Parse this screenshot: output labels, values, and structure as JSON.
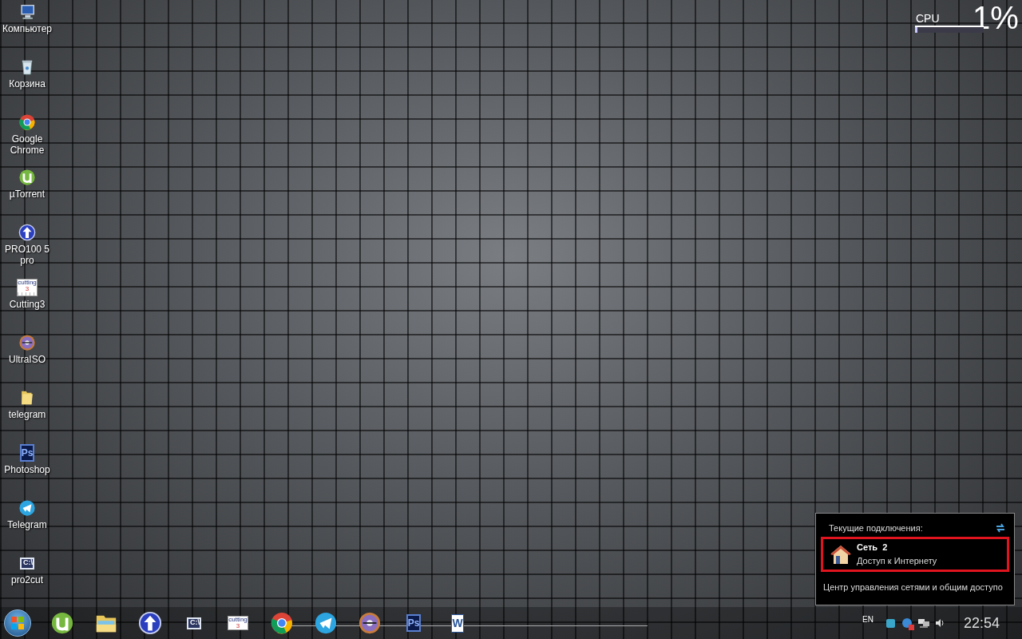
{
  "desktop_icons": [
    {
      "kind": "computer",
      "label": "Компьютер"
    },
    {
      "kind": "trash",
      "label": "Корзина"
    },
    {
      "kind": "chrome",
      "label": "Google Chrome"
    },
    {
      "kind": "utorrent",
      "label": "µTorrent"
    },
    {
      "kind": "upload",
      "label": "PRO100 5 pro"
    },
    {
      "kind": "cutting",
      "label": "Cutting3",
      "icon_text": [
        "cutting",
        "3"
      ]
    },
    {
      "kind": "disc",
      "label": "UltraISO"
    },
    {
      "kind": "folder",
      "label": "telegram"
    },
    {
      "kind": "photoshop",
      "label": "Photoshop",
      "icon_text": [
        "Ps"
      ]
    },
    {
      "kind": "telegram",
      "label": "Telegram"
    },
    {
      "kind": "console",
      "label": "pro2cut",
      "icon_text": [
        "C:\\"
      ]
    }
  ],
  "cpu_gadget": {
    "label": "CPU",
    "value": "1%",
    "level": 0.03
  },
  "network_popup": {
    "header": "Текущие подключения:",
    "connection": {
      "name": "Сеть  2",
      "status": "Доступ к Интернету",
      "selected": true
    },
    "link": "Центр управления сетями и общим доступо"
  },
  "taskbar": {
    "pinned": [
      {
        "kind": "utorrent"
      },
      {
        "kind": "explorer"
      },
      {
        "kind": "upload"
      },
      {
        "kind": "console",
        "icon_text": [
          "C:\\"
        ]
      },
      {
        "kind": "cutting",
        "icon_text": [
          "cutting",
          "3"
        ]
      },
      {
        "kind": "chrome"
      },
      {
        "kind": "telegram"
      },
      {
        "kind": "disc"
      },
      {
        "kind": "photoshop",
        "icon_text": [
          "Ps"
        ]
      },
      {
        "kind": "word",
        "icon_text": [
          "W"
        ]
      }
    ],
    "tray": {
      "language": "EN",
      "clock": "22:54"
    }
  }
}
